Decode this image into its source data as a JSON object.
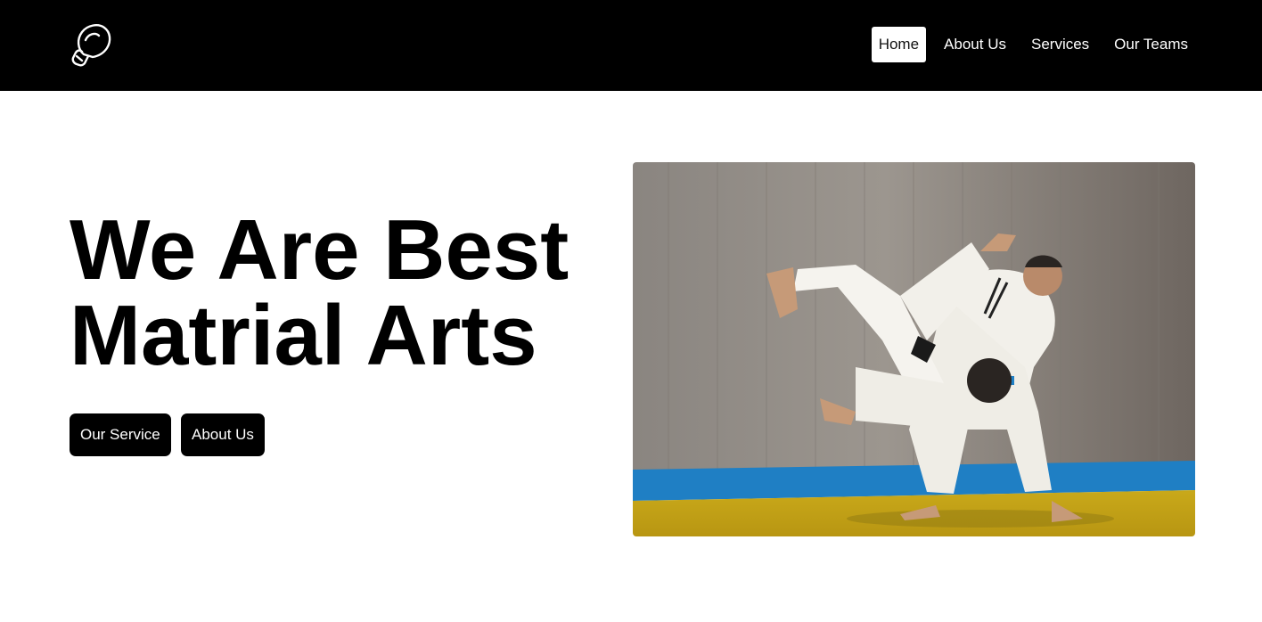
{
  "navbar": {
    "logo_icon": "boxing-glove-icon",
    "links": [
      {
        "label": "Home",
        "active": true
      },
      {
        "label": "About Us",
        "active": false
      },
      {
        "label": "Services",
        "active": false
      },
      {
        "label": "Our Teams",
        "active": false
      }
    ]
  },
  "hero": {
    "title_line_1": "We Are Best",
    "title_line_2": "Matrial Arts",
    "buttons": {
      "our_service": "Our Service",
      "about_us": "About Us"
    },
    "image_subject": "judo-throw-photo"
  },
  "colors": {
    "nav_background": "#000000",
    "page_background": "#ffffff",
    "button_background": "#000000",
    "mat_blue": "#1f7fc4",
    "mat_yellow": "#d9b81e"
  }
}
